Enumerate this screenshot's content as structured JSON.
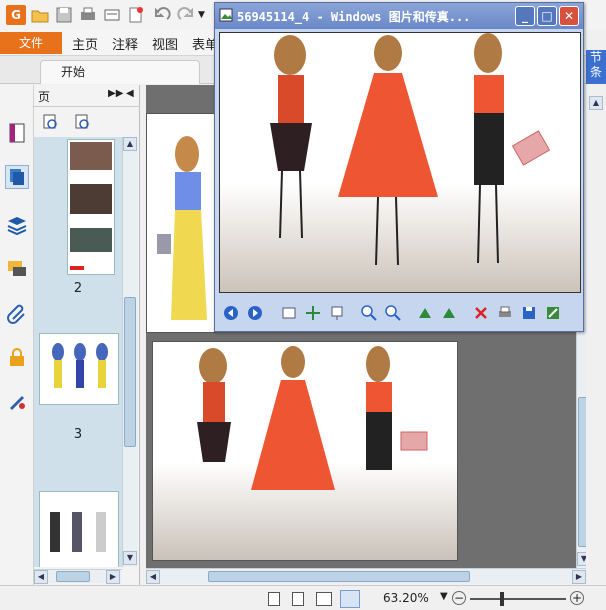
{
  "app": {
    "menu": {
      "file_label": "文件",
      "items": [
        "主页",
        "注释",
        "视图",
        "表单"
      ]
    },
    "tab": {
      "label": "开始"
    },
    "thumbs": {
      "header_label": "页",
      "page_numbers": [
        "2",
        "3"
      ]
    },
    "right_strip": {
      "label1": "节",
      "label2": "条"
    },
    "status": {
      "zoom": "63.20%"
    },
    "colors": {
      "accent": "#e8711c",
      "viewer_title": "#6a88c8",
      "thumb_bg": "#cfe0ea"
    }
  },
  "viewer": {
    "title": "56945114_4 - Windows 图片和传真...",
    "buttons": {
      "minimize": "_",
      "maximize": "□",
      "close": "✕"
    }
  }
}
